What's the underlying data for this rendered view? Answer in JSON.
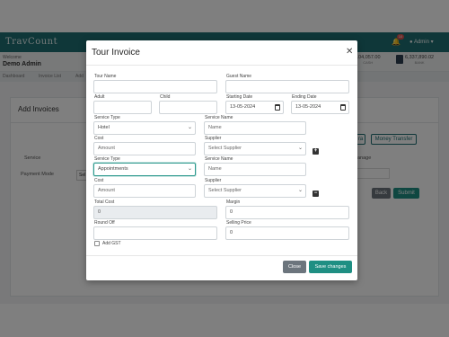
{
  "app": {
    "logo": "TravCount",
    "notification_count": "10",
    "admin_label": "Admin",
    "welcome_label": "Welcome",
    "user_name": "Demo Admin",
    "stats": [
      {
        "value": "104,057.00",
        "label": "CASH"
      },
      {
        "value": "6,337,890.02",
        "label": "BANK"
      }
    ],
    "breadcrumbs": [
      "Dashboard",
      "Invoice List",
      "Add"
    ]
  },
  "page": {
    "card_title": "Add Invoices",
    "service_label": "Service",
    "payment_mode_label": "Payment Mode",
    "payment_mode_value": "Sel",
    "manage_label": "anage",
    "buttons": {
      "tra": "ra",
      "money_transfer": "Money Transfer",
      "back": "Back",
      "submit": "Submit"
    },
    "colors": {
      "primary": "#1f6f73",
      "submit": "#1f8f83",
      "back": "#6c757d"
    }
  },
  "modal": {
    "title": "Tour Invoice",
    "close_icon": "close-icon",
    "tour_name": {
      "label": "Tour Name",
      "value": ""
    },
    "guest_name": {
      "label": "Guest Name",
      "value": ""
    },
    "adult": {
      "label": "Adult",
      "value": ""
    },
    "child": {
      "label": "Child",
      "value": ""
    },
    "starting_date": {
      "label": "Starting Date",
      "value": "13-05-2024"
    },
    "ending_date": {
      "label": "Ending Date",
      "value": "13-05-2024"
    },
    "services": [
      {
        "service_type_label": "Service Type",
        "service_type_value": "Hotel",
        "service_name_label": "Service Name",
        "service_name_placeholder": "Name",
        "cost_label": "Cost",
        "cost_placeholder": "Amount",
        "supplier_label": "Supplier",
        "supplier_value": "Select Supplier",
        "row_action": "+"
      },
      {
        "service_type_label": "Service Type",
        "service_type_value": "Appointments",
        "service_name_label": "Service Name",
        "service_name_placeholder": "Name",
        "cost_label": "Cost",
        "cost_placeholder": "Amount",
        "supplier_label": "Supplier",
        "supplier_value": "Select Supplier",
        "row_action": "−"
      }
    ],
    "total_cost": {
      "label": "Total Cost",
      "value": "0"
    },
    "margin": {
      "label": "Margin",
      "value": "0"
    },
    "round_off": {
      "label": "Round Off",
      "value": ""
    },
    "selling_price": {
      "label": "Selling Price",
      "value": "0"
    },
    "add_gst_label": "Add GST",
    "close_button": "Close",
    "save_button": "Save changes"
  }
}
